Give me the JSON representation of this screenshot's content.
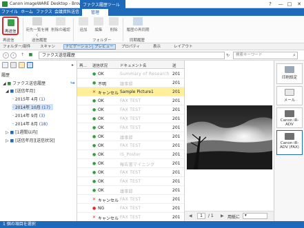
{
  "window": {
    "title": "Canon imageWARE Desktop - Browser",
    "context_tab_header": "ファクス履歴ツール"
  },
  "ribbon_tabs": [
    "ファイル",
    "ホーム",
    "ファクス",
    "会議資料送信画",
    "管理"
  ],
  "ribbon": {
    "resend": "再送信",
    "open_list": "宛先一覧を開く",
    "delete_confirm": "削除の確認",
    "group_resend": "再送信",
    "group_history": "送信履歴",
    "add": "追加",
    "edit": "編集",
    "delete": "削除",
    "group_folder": "フォルダー",
    "history_resync": "履歴の再同期",
    "group_history2": "同期履歴"
  },
  "view_bar": {
    "folder_parts": "フォルダー/部件",
    "scan": "スキャン",
    "navigation": "ナビゲーション",
    "preview": "プレビュー",
    "property": "プロパティ",
    "display": "表示",
    "layout": "レイアウト"
  },
  "address": {
    "path": "ファクス送信履歴",
    "search_placeholder": "検索キーワード"
  },
  "left_panel": {
    "history_label": "履歴",
    "root": "ファクス送信履歴",
    "by_month": "[送信年月]",
    "months": [
      {
        "label": "2015年 4月",
        "count": "(1)"
      },
      {
        "label": "2014年 10月",
        "count": "(17)"
      },
      {
        "label": "2014年 9月",
        "count": "(3)"
      },
      {
        "label": "2014年 8月",
        "count": "(18)"
      }
    ],
    "by_dest": "[1週間以内]",
    "by_status": "[送信年月][送信状況]"
  },
  "list": {
    "headers": [
      "再…",
      "送信状況",
      "ドキュメント名",
      "送"
    ],
    "rows": [
      {
        "status": "OK",
        "status_icon": "check",
        "name": "Summary of Research",
        "date": "201"
      },
      {
        "status": "不明",
        "status_icon": "check",
        "name": "議事録",
        "date": "201"
      },
      {
        "status": "キャンセル",
        "status_icon": "cross",
        "name": "Sample Picture1",
        "date": "201"
      },
      {
        "status": "OK",
        "status_icon": "check",
        "name": "FAX TEST",
        "date": "201"
      },
      {
        "status": "OK",
        "status_icon": "check",
        "name": "FAX TEST",
        "date": "201"
      },
      {
        "status": "OK",
        "status_icon": "check",
        "name": "FAX TEST",
        "date": "201"
      },
      {
        "status": "OK",
        "status_icon": "check",
        "name": "FAX TEST",
        "date": "201"
      },
      {
        "status": "OK",
        "status_icon": "check",
        "name": "議事録",
        "date": "201"
      },
      {
        "status": "OK",
        "status_icon": "check",
        "name": "FAX TEST",
        "date": "201"
      },
      {
        "status": "OK",
        "status_icon": "check",
        "name": "IS_Poster",
        "date": "201"
      },
      {
        "status": "OK",
        "status_icon": "check",
        "name": "報告書マイニング",
        "date": "201"
      },
      {
        "status": "OK",
        "status_icon": "check",
        "name": "FAX TEST",
        "date": "201"
      },
      {
        "status": "OK",
        "status_icon": "check",
        "name": "FAX TEST",
        "date": "201"
      },
      {
        "status": "OK",
        "status_icon": "check",
        "name": "議事録",
        "date": "201"
      },
      {
        "status": "キャンセル",
        "status_icon": "cross",
        "name": "FAX TEST",
        "date": "201"
      },
      {
        "status": "NG",
        "status_icon": "ng",
        "name": "FAX TEST",
        "date": "201"
      },
      {
        "status": "キャンセル",
        "status_icon": "cross",
        "name": "FAX TEST",
        "date": "201"
      }
    ]
  },
  "preview": {
    "page": "1",
    "of": "/ 1",
    "zoom": "用紙に"
  },
  "side_buttons": [
    "印刷設定",
    "メール",
    "Canon iR-ADV",
    "Canon iR-ADV (FAX)"
  ],
  "status_bar": "1 個の項目を選択",
  "colors": {
    "accent": "#1e69b9",
    "selected_row": "#ffef99",
    "ok": "#2e9e3e",
    "cancel": "#e0262b"
  }
}
